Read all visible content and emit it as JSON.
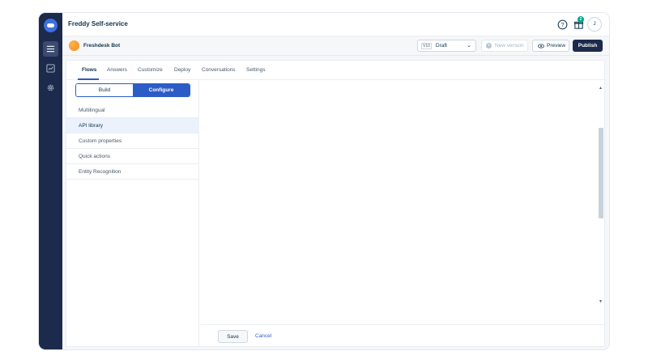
{
  "app": {
    "title": "Freddy Self-service"
  },
  "header": {
    "notification_count": "2",
    "avatar_initial": "J"
  },
  "rail": {
    "items": [
      {
        "icon": "list-icon"
      },
      {
        "icon": "analytics-icon"
      },
      {
        "icon": "gear-icon"
      }
    ]
  },
  "bot": {
    "name": "Freshdesk Bot",
    "version_tag": "V10",
    "version_status": "Draft",
    "new_version_label": "New version",
    "preview_label": "Preview",
    "publish_label": "Publish"
  },
  "tabs": [
    "Flows",
    "Answers",
    "Customize",
    "Deploy",
    "Conversations",
    "Settings"
  ],
  "active_tab": "Flows",
  "segment": {
    "build": "Build",
    "configure": "Configure",
    "selected": "Configure"
  },
  "menu": [
    "Multilingual",
    "API library",
    "Custom properties",
    "Quick actions",
    "Entity Recognition"
  ],
  "active_menu": "API library",
  "footer": {
    "save_label": "Save",
    "cancel_label": "Cancel"
  },
  "colors": {
    "rail": "#1c2a4b",
    "accent": "#2c5cc5",
    "publish": "#1c2a4b",
    "badge": "#00a886"
  }
}
